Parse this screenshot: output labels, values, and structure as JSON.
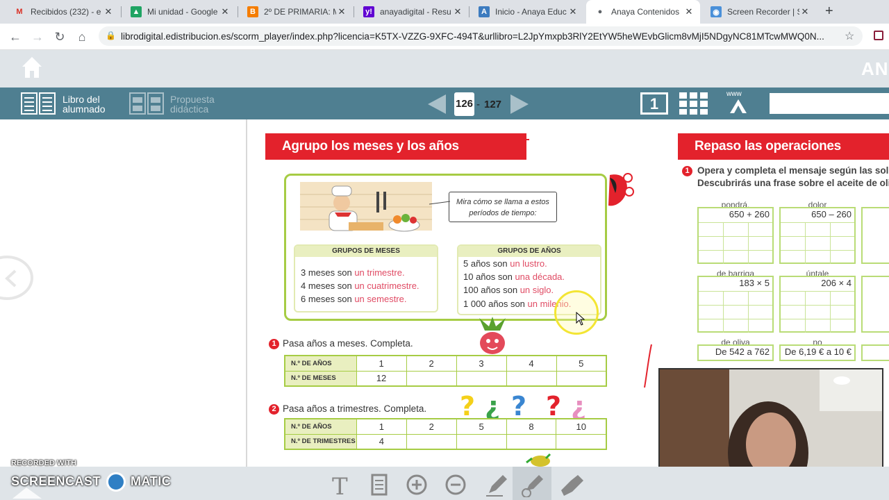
{
  "browser": {
    "tabs": [
      {
        "title": "Recibidos (232) - e",
        "icon": "gmail-icon",
        "color": "#d93025",
        "glyph": "M"
      },
      {
        "title": "Mi unidad - Google",
        "icon": "drive-icon",
        "color": "#1fa463",
        "glyph": "▲"
      },
      {
        "title": "2º DE PRIMARIA: M",
        "icon": "blogger-icon",
        "color": "#f57d00",
        "glyph": "B"
      },
      {
        "title": "anayadigital - Resu",
        "icon": "yahoo-icon",
        "color": "#6001d2",
        "glyph": "y!"
      },
      {
        "title": "Inicio - Anaya Educ",
        "icon": "anaya-icon",
        "color": "#3c7bbf",
        "glyph": "A"
      },
      {
        "title": "Anaya Contenidos",
        "icon": "globe-icon",
        "color": "#5f6368",
        "glyph": "●"
      },
      {
        "title": "Screen Recorder | S",
        "icon": "screencast-icon",
        "color": "#4a90d9",
        "glyph": "◉"
      }
    ],
    "url": "librodigital.edistribucion.es/scorm_player/index.php?licencia=K5TX-VZZG-9XFC-494T&urllibro=L2JpYmxpb3RlY2EtYW5heWEvbGlicm8vMjI5NDgyNC81MTcwMWQ0N..."
  },
  "app": {
    "brand": "AN",
    "book_label": "Libro del alumnado",
    "book_label_1": "Libro del",
    "book_label_2": "alumnado",
    "proposal_label_1": "Propuesta",
    "proposal_label_2": "didáctica",
    "page_left": "126",
    "page_sep": "-",
    "page_right": "127",
    "single_page_icon": "1",
    "www": "www"
  },
  "left_page": {
    "banner": "Agrupo los meses y los años",
    "bubble": "Mira cómo se llama a estos períodos de tiempo:",
    "months_group": {
      "title": "GRUPOS DE MESES",
      "lines": [
        {
          "pre": "3 meses son ",
          "red": "un trimestre."
        },
        {
          "pre": "4 meses son ",
          "red": "un cuatrimestre."
        },
        {
          "pre": "6 meses son ",
          "red": "un semestre."
        }
      ]
    },
    "years_group": {
      "title": "GRUPOS DE AÑOS",
      "lines": [
        {
          "pre": "5 años son ",
          "red": "un lustro."
        },
        {
          "pre": "10 años son ",
          "red": "una década."
        },
        {
          "pre": "100 años son ",
          "red": "un siglo."
        },
        {
          "pre": "1 000 años son ",
          "red": "un milenio."
        }
      ]
    },
    "exercise1": {
      "num": "1",
      "text": "Pasa años a meses. Completa.",
      "row1_label": "N.º DE AÑOS",
      "row1": [
        "1",
        "2",
        "3",
        "4",
        "5"
      ],
      "row2_label": "N.º DE MESES",
      "row2": [
        "12",
        "",
        "",
        "",
        ""
      ]
    },
    "exercise2": {
      "num": "2",
      "text": "Pasa años a trimestres. Completa.",
      "row1_label": "N.º DE AÑOS",
      "row1": [
        "1",
        "2",
        "5",
        "8",
        "10"
      ],
      "row2_label": "N.º DE TRIMESTRES",
      "row2": [
        "4",
        "",
        "",
        "",
        ""
      ]
    }
  },
  "right_page": {
    "banner": "Repaso las operaciones",
    "num": "1",
    "instr1": "Opera y completa el mensaje según las solu",
    "instr2": "Descubrirás una frase sobre el aceite de oli",
    "grids": [
      {
        "label": "pondrá.",
        "op": "650 + 260"
      },
      {
        "label": "dolor",
        "op": "650 – 260"
      },
      {
        "label": "de barriga",
        "op": "183 × 5"
      },
      {
        "label": "úntale",
        "op": "206 × 4"
      },
      {
        "label": "de oliva",
        "op": "De 542 a 762"
      },
      {
        "label": "no",
        "op": "De 6,19 € a 10 €"
      }
    ]
  },
  "recorder": {
    "line1": "RECORDED WITH",
    "line2a": "SCREENCAST",
    "line2b": "MATIC"
  }
}
